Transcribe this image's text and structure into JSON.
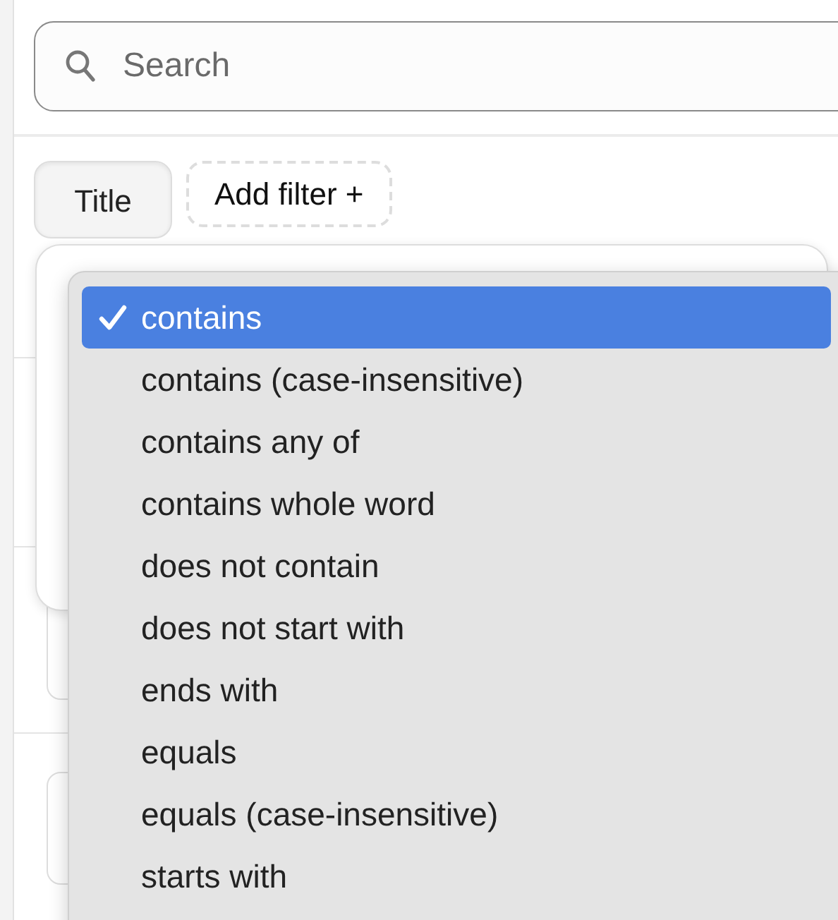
{
  "search": {
    "placeholder": "Search"
  },
  "filters": [
    {
      "label": "Title",
      "kind": "chip"
    },
    {
      "label": "Add filter +",
      "kind": "add"
    }
  ],
  "dropdown": {
    "options": [
      {
        "label": "contains",
        "selected": true
      },
      {
        "label": "contains (case-insensitive)",
        "selected": false
      },
      {
        "label": "contains any of",
        "selected": false
      },
      {
        "label": "contains whole word",
        "selected": false
      },
      {
        "label": "does not contain",
        "selected": false
      },
      {
        "label": "does not start with",
        "selected": false
      },
      {
        "label": "ends with",
        "selected": false
      },
      {
        "label": "equals",
        "selected": false
      },
      {
        "label": "equals (case-insensitive)",
        "selected": false
      },
      {
        "label": "starts with",
        "selected": false
      }
    ]
  }
}
